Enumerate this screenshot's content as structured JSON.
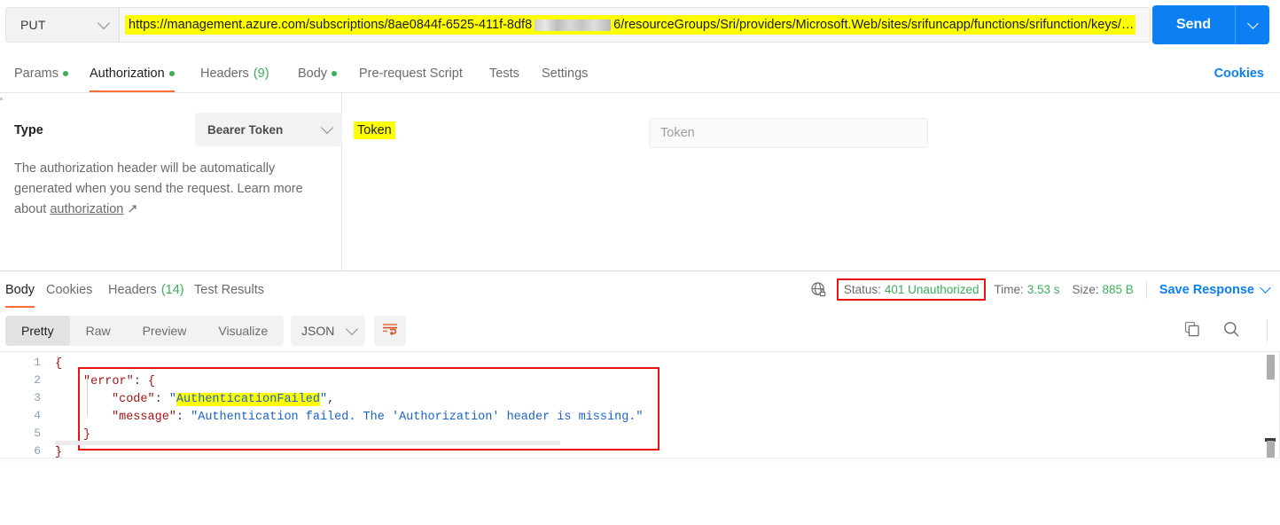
{
  "request": {
    "method": "PUT",
    "url_prefix": "https://management.azure.com/subscriptions/8ae0844f-6525-411f-8df8",
    "url_suffix": "6/resourceGroups/Sri/providers/Microsoft.Web/sites/srifuncapp/functions/srifunction/keys/…",
    "send_label": "Send",
    "tabs": [
      {
        "label": "Params",
        "dot": true,
        "active": false
      },
      {
        "label": "Authorization",
        "dot": true,
        "active": true
      },
      {
        "label": "Headers",
        "count": "(9)",
        "active": false
      },
      {
        "label": "Body",
        "dot": true,
        "active": false
      },
      {
        "label": "Pre-request Script",
        "active": false
      },
      {
        "label": "Tests",
        "active": false
      },
      {
        "label": "Settings",
        "active": false
      }
    ],
    "cookies_label": "Cookies"
  },
  "auth": {
    "type_label": "Type",
    "type_value": "Bearer Token",
    "description_part1": "The authorization header will be automatically generated when you send the request. Learn more about ",
    "description_link": "authorization",
    "description_arrow": "↗",
    "token_label": "Token",
    "token_placeholder": "Token",
    "token_value": ""
  },
  "response": {
    "tabs": [
      {
        "label": "Body",
        "active": true
      },
      {
        "label": "Cookies",
        "active": false
      },
      {
        "label": "Headers",
        "count": "(14)",
        "active": false
      },
      {
        "label": "Test Results",
        "active": false
      }
    ],
    "status_label": "Status:",
    "status_value": "401 Unauthorized",
    "time_label": "Time:",
    "time_value": "3.53 s",
    "size_label": "Size:",
    "size_value": "885 B",
    "save_response_label": "Save Response",
    "view_modes": [
      {
        "label": "Pretty",
        "active": true
      },
      {
        "label": "Raw",
        "active": false
      },
      {
        "label": "Preview",
        "active": false
      },
      {
        "label": "Visualize",
        "active": false
      }
    ],
    "format": "JSON",
    "body_lines": [
      {
        "n": "1",
        "text": "{"
      },
      {
        "n": "2",
        "text": "    \"error\": {"
      },
      {
        "n": "3",
        "text": "        \"code\": \"AuthenticationFailed\","
      },
      {
        "n": "4",
        "text": "        \"message\": \"Authentication failed. The 'Authorization' header is missing.\""
      },
      {
        "n": "5",
        "text": "    }"
      },
      {
        "n": "6",
        "text": "}"
      }
    ],
    "code_tokens": {
      "l1_brace": "{",
      "l2_key": "\"error\"",
      "l2_colon": ": ",
      "l2_brace": "{",
      "l3_key": "\"code\"",
      "l3_colon": ": ",
      "l3_quote_open": "\"",
      "l3_value": "AuthenticationFailed",
      "l3_quote_close": "\"",
      "l3_comma": ",",
      "l4_key": "\"message\"",
      "l4_colon": ": ",
      "l4_value": "\"Authentication failed. The 'Authorization' header is missing.\"",
      "l5_brace": "}",
      "l6_brace": "}"
    }
  },
  "icons": {
    "chevron_down": "chevron-down-icon",
    "globe_lock": "globe-lock-icon",
    "copy": "copy-icon",
    "search": "search-icon",
    "wrap": "word-wrap-icon"
  },
  "colors": {
    "accent": "#ff6c37",
    "primary": "#0c7ff2",
    "success": "#3aae5c",
    "highlight": "#ffff00",
    "annotation": "#ee1111"
  }
}
